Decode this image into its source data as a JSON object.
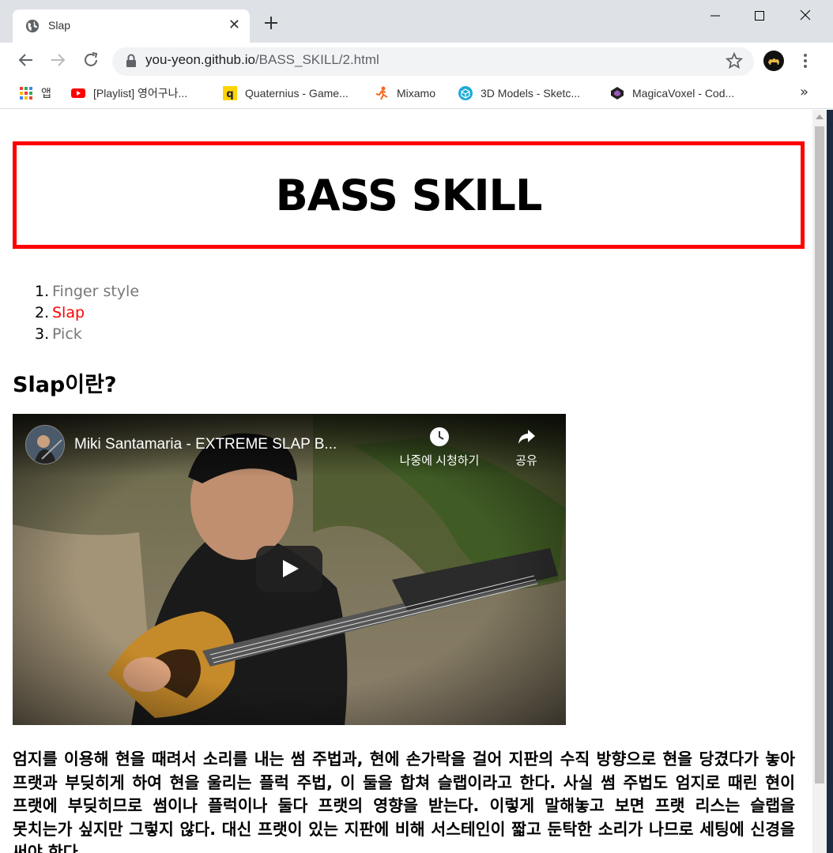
{
  "browser": {
    "tab_title": "Slap",
    "url_host": "you-yeon.github.io",
    "url_path": "/BASS_SKILL/2.html",
    "bookmarks": [
      {
        "label": "앱",
        "icon": "apps-grid-icon"
      },
      {
        "label": "[Playlist] 영어구나...",
        "icon": "youtube-icon"
      },
      {
        "label": "Quaternius - Game...",
        "icon": "quaternius-icon"
      },
      {
        "label": "Mixamo",
        "icon": "mixamo-icon"
      },
      {
        "label": "3D Models - Sketc...",
        "icon": "sketchfab-icon"
      },
      {
        "label": "MagicaVoxel - Cod...",
        "icon": "codepen-icon"
      }
    ],
    "bookmarks_more": "»"
  },
  "page": {
    "title": "BASS SKILL",
    "nav": [
      {
        "num": "1.",
        "label": "Finger style",
        "active": false
      },
      {
        "num": "2.",
        "label": "Slap",
        "active": true
      },
      {
        "num": "3.",
        "label": "Pick",
        "active": false
      }
    ],
    "section_title": "Slap이란?",
    "video": {
      "title": "Miki Santamaria - EXTREME SLAP B...",
      "watch_later": "나중에 시청하기",
      "share": "공유"
    },
    "paragraph": "엄지를 이용해 현을 때려서 소리를 내는 썸 주법과, 현에 손가락을 걸어 지판의 수직 방향으로 현을 당겼다가 놓아 프랫과 부딪히게 하여 현을 울리는 플럭 주법, 이 둘을 합쳐 슬랩이라고 한다. 사실 썸 주법도 엄지로 때린 현이 프랫에 부딪히므로 썸이나 플럭이나 둘다 프랫의 영향을 받는다. 이렇게 말해놓고 보면 프랫 리스는 슬랩을 못치는가 싶지만 그렇지 않다. 대신 프랫이 있는 지판에 비해 서스테인이 짧고 둔탁한 소리가 나므로 세팅에 신경을 써야 한다."
  },
  "colors": {
    "accent_red": "#ff0000",
    "link_gray": "#777777"
  }
}
